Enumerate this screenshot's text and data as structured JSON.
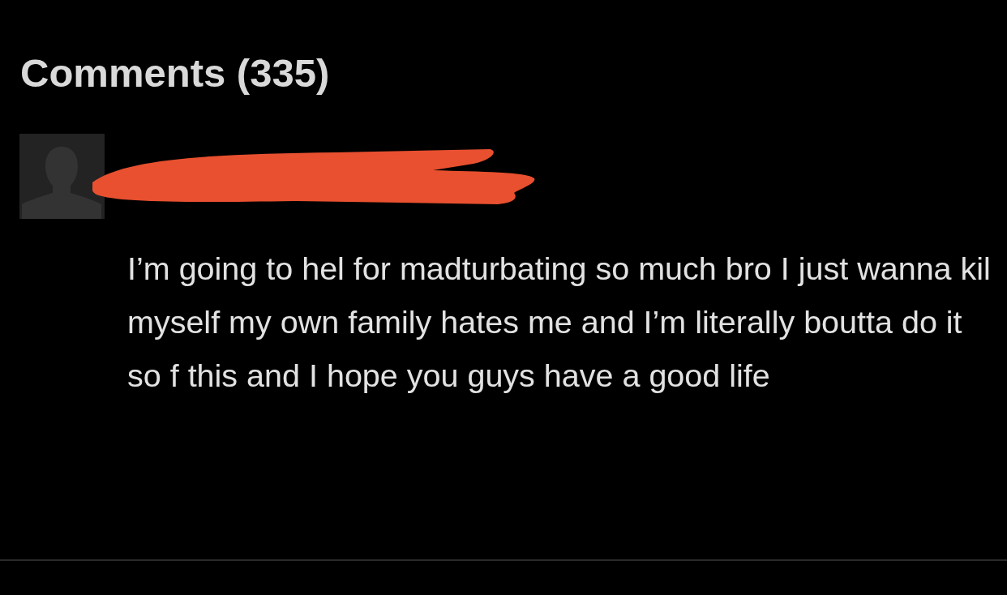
{
  "heading": "Comments (335)",
  "comments": [
    {
      "author": {
        "redacted": true
      },
      "text": "I’m going to hel for madturbating so much bro I just wanna kil myself my own family hates me and I’m literally boutta do it so f this and I hope you guys have a good life"
    }
  ]
}
